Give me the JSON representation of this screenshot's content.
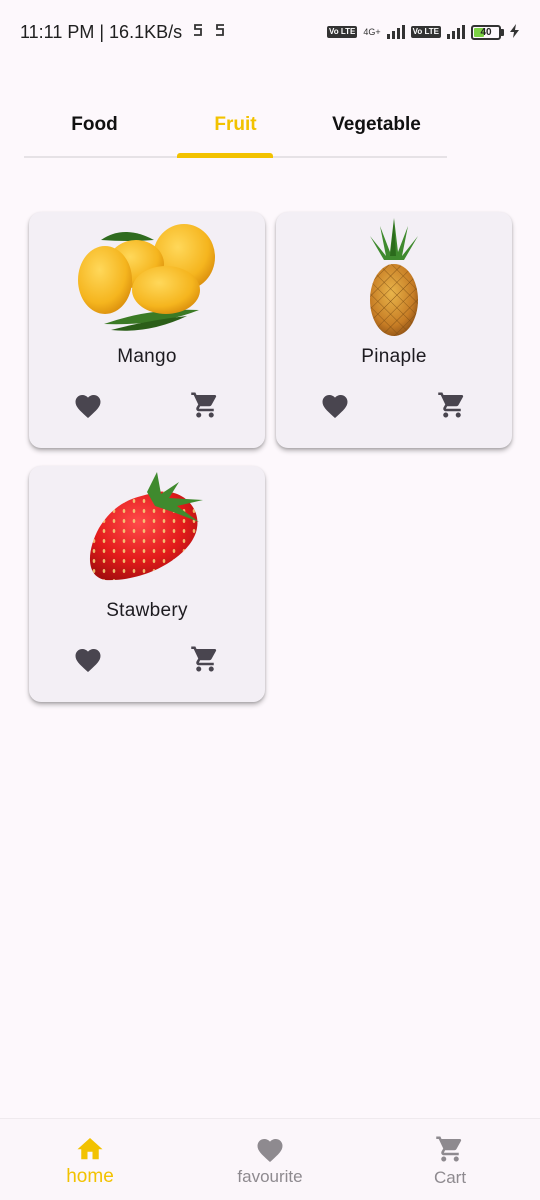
{
  "status_bar": {
    "time_speed": "11:11 PM | 16.1KB/s",
    "sim1_badge": "Vo LTE",
    "network_type": "4G+",
    "sim2_badge": "Vo LTE",
    "battery_level": "40",
    "battery_fraction": 0.4,
    "battery_color": "#7cd244"
  },
  "tabs": [
    {
      "label": "Food",
      "active": false
    },
    {
      "label": "Fruit",
      "active": true
    },
    {
      "label": "Vegetable",
      "active": false
    }
  ],
  "accent_color": "#f2c200",
  "products": [
    {
      "name": "Mango",
      "image_icon": "mango-image",
      "fav_icon": "heart-icon",
      "cart_icon": "cart-icon"
    },
    {
      "name": "Pinaple",
      "image_icon": "pineapple-image",
      "fav_icon": "heart-icon",
      "cart_icon": "cart-icon"
    },
    {
      "name": "Stawbery",
      "image_icon": "strawberry-image",
      "fav_icon": "heart-icon",
      "cart_icon": "cart-icon"
    }
  ],
  "bottom_nav": [
    {
      "label": "home",
      "icon": "home-icon",
      "active": true
    },
    {
      "label": "favourite",
      "icon": "heart-icon",
      "active": false
    },
    {
      "label": "Cart",
      "icon": "cart-icon",
      "active": false
    }
  ]
}
